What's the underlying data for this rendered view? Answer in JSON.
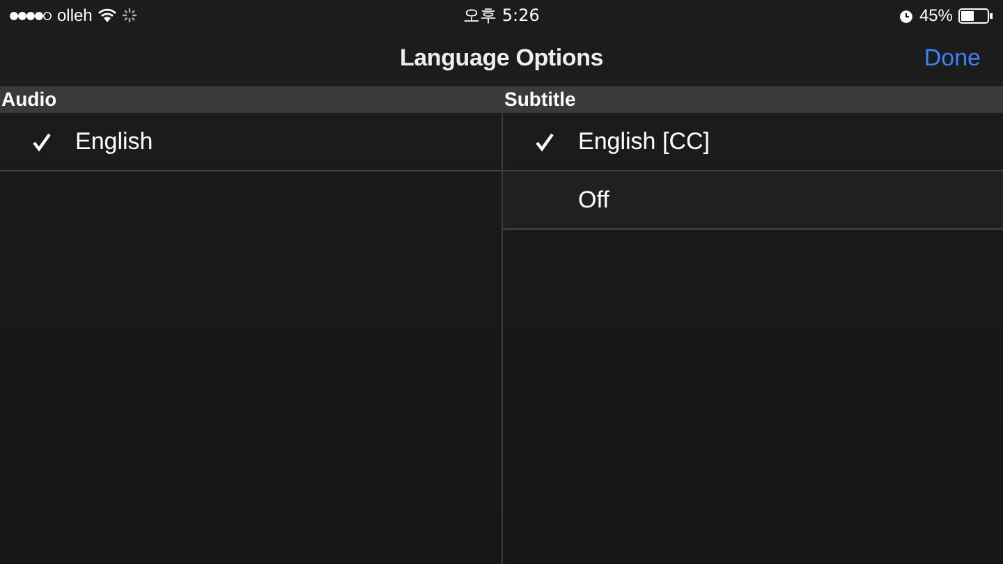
{
  "status_bar": {
    "carrier": "olleh",
    "time": "오후 5:26",
    "battery": "45%"
  },
  "nav": {
    "title": "Language Options",
    "done": "Done"
  },
  "sections": [
    {
      "title": "Audio",
      "items": [
        {
          "label": "English",
          "selected": true
        }
      ]
    },
    {
      "title": "Subtitle",
      "items": [
        {
          "label": "English [CC]",
          "selected": true
        },
        {
          "label": "Off",
          "selected": false
        }
      ]
    }
  ]
}
